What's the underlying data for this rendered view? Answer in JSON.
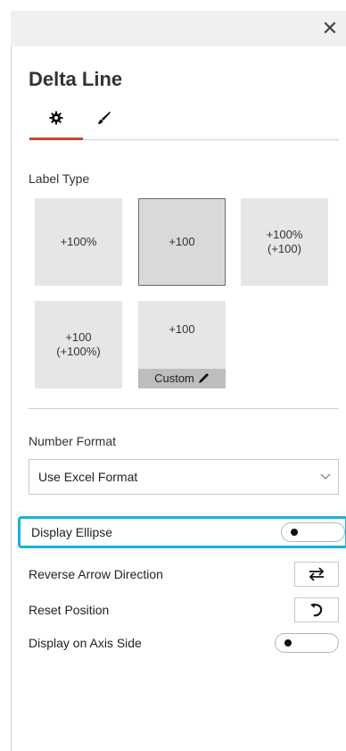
{
  "window": {
    "close_glyph": "✕"
  },
  "pane": {
    "title": "Delta Line"
  },
  "tabs": [
    {
      "icon": "gear-icon",
      "selected": true
    },
    {
      "icon": "paintbrush-icon",
      "selected": false
    }
  ],
  "label_type": {
    "heading": "Label Type",
    "options": [
      {
        "line1": "+100%",
        "line2": ""
      },
      {
        "line1": "+100",
        "line2": "",
        "selected": true
      },
      {
        "line1": "+100%",
        "line2": "(+100)"
      },
      {
        "line1": "+100",
        "line2": "(+100%)"
      },
      {
        "line1": "+100",
        "custom_label": "Custom"
      }
    ]
  },
  "number_format": {
    "heading": "Number Format",
    "selected": "Use Excel Format"
  },
  "settings": {
    "display_ellipse": {
      "label": "Display Ellipse",
      "on": false
    },
    "reverse_arrow": {
      "label": "Reverse Arrow Direction"
    },
    "reset_position": {
      "label": "Reset Position"
    },
    "axis_side": {
      "label": "Display on Axis Side",
      "on": false
    }
  },
  "colors": {
    "accent": "#c8462f",
    "highlight": "#16b4d8"
  }
}
